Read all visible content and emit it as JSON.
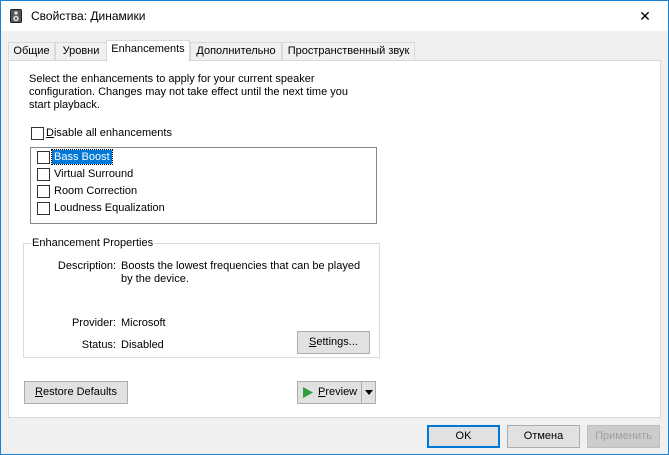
{
  "window": {
    "title": "Свойства: Динамики",
    "close_glyph": "✕"
  },
  "tabs": [
    {
      "label": "Общие",
      "active": false
    },
    {
      "label": "Уровни",
      "active": false
    },
    {
      "label": "Enhancements",
      "active": true
    },
    {
      "label": "Дополнительно",
      "active": false
    },
    {
      "label": "Пространственный звук",
      "active": false
    }
  ],
  "enhancements": {
    "description": "Select the enhancements to apply for your current speaker configuration. Changes may not take effect until the next time you start playback.",
    "disable_all": {
      "label_first": "D",
      "label_rest": "isable all enhancements",
      "checked": false
    },
    "items": [
      {
        "label": "Bass Boost",
        "checked": false,
        "selected": true
      },
      {
        "label": "Virtual Surround",
        "checked": false,
        "selected": false
      },
      {
        "label": "Room Correction",
        "checked": false,
        "selected": false
      },
      {
        "label": "Loudness Equalization",
        "checked": false,
        "selected": false
      }
    ],
    "properties": {
      "group_title": "Enhancement Properties",
      "description_label": "Description:",
      "description_value": "Boosts the lowest frequencies that can be played by the device.",
      "provider_label": "Provider:",
      "provider_value": "Microsoft",
      "status_label": "Status:",
      "status_value": "Disabled",
      "settings_first": "S",
      "settings_rest": "ettings..."
    },
    "restore_first": "R",
    "restore_rest": "estore Defaults",
    "preview_first": "P",
    "preview_rest": "review"
  },
  "footer": {
    "ok": "OK",
    "cancel": "Отмена",
    "apply": "Применить"
  },
  "colors": {
    "accent": "#0078d7",
    "selection": "#0078d7",
    "play_green": "#2ea043"
  }
}
